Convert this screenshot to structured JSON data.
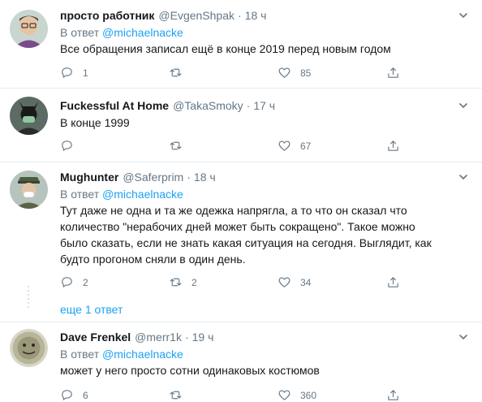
{
  "tweets": [
    {
      "name": "просто работник",
      "handle": "@EvgenShpak",
      "time": "18 ч",
      "reply_prefix": "В ответ",
      "reply_to": "@michaelnacke",
      "text": "Все обращения записал ещё в конце 2019 перед новым годом",
      "replies": "1",
      "retweets": "",
      "likes": "85"
    },
    {
      "name": "Fuckessful At Home",
      "handle": "@TakaSmoky",
      "time": "17 ч",
      "text": "В конце 1999",
      "replies": "",
      "retweets": "",
      "likes": "67"
    },
    {
      "name": "Mughunter",
      "handle": "@Saferprim",
      "time": "18 ч",
      "reply_prefix": "В ответ",
      "reply_to": "@michaelnacke",
      "text_lines": [
        "Тут даже не одна и та же одежка напрягла, а то что он сказал что",
        "количество \"нерабочих дней может быть сокращено\". Такое можно",
        "было сказать, если не знать какая ситуация на сегодня. Выглядит, как",
        "будто прогоном сняли в один день."
      ],
      "replies": "2",
      "retweets": "2",
      "likes": "34"
    },
    {
      "name": "Dave Frenkel",
      "handle": "@merr1k",
      "time": "19 ч",
      "reply_prefix": "В ответ",
      "reply_to": "@michaelnacke",
      "text": "может у него просто сотни одинаковых костюмов",
      "replies": "6",
      "retweets": "",
      "likes": "360"
    }
  ],
  "more_replies": "еще 1 ответ",
  "icons": [
    "reply-icon",
    "retweet-icon",
    "like-icon",
    "share-icon",
    "chevron-down-icon"
  ],
  "colors": {
    "accent": "#1da1f2",
    "secondary": "#657786",
    "divider": "#e6ecf0"
  }
}
